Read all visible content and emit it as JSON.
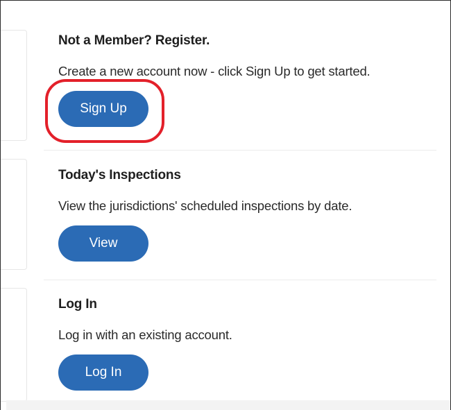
{
  "sections": [
    {
      "title": "Not a Member? Register.",
      "description": "Create a new account now - click Sign Up to get started.",
      "button_label": "Sign Up",
      "highlighted": true
    },
    {
      "title": "Today's Inspections",
      "description": "View the jurisdictions' scheduled inspections by date.",
      "button_label": "View",
      "highlighted": false
    },
    {
      "title": "Log In",
      "description": "Log in with an existing account.",
      "button_label": "Log In",
      "highlighted": false
    }
  ],
  "colors": {
    "button_bg": "#2b6bb5",
    "button_text": "#ffffff",
    "highlight_ring": "#e3202a",
    "divider": "#ececec"
  }
}
